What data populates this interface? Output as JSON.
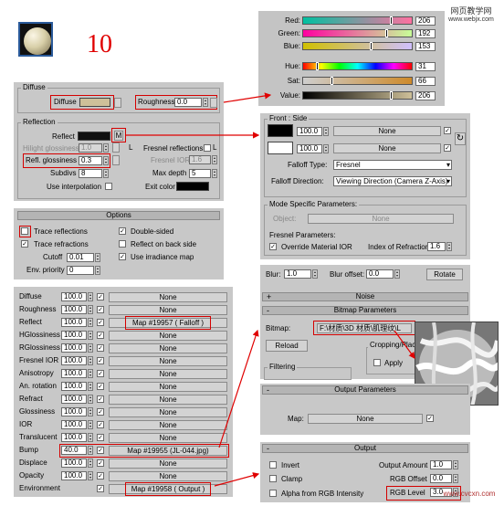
{
  "step_number": "10",
  "color_picker": {
    "channels": [
      {
        "label": "Red:",
        "value": "206"
      },
      {
        "label": "Green:",
        "value": "192"
      },
      {
        "label": "Blue:",
        "value": "153"
      },
      {
        "label": "Hue:",
        "value": "31"
      },
      {
        "label": "Sat:",
        "value": "66"
      },
      {
        "label": "Value:",
        "value": "206"
      }
    ],
    "swatch_color": "#cec099"
  },
  "watermark": {
    "line1": "网页教学网",
    "line2": "www.webjx.com"
  },
  "basic": {
    "diffuse_title": "Diffuse",
    "diffuse_label": "Diffuse",
    "roughness_label": "Roughness",
    "roughness_value": "0.0",
    "reflection_title": "Reflection",
    "reflect_label": "Reflect",
    "m_button": "M",
    "hilight_gloss_label": "Hilight glossiness",
    "hilight_gloss_value": "1.0",
    "l_button": "L",
    "fresnel_label": "Fresnel reflections",
    "refl_gloss_label": "Refl. glossiness",
    "refl_gloss_value": "0.3",
    "fresnel_ior_label": "Fresnel IOR",
    "fresnel_ior_value": "1.6",
    "subdivs_label": "Subdivs",
    "subdivs_value": "8",
    "max_depth_label": "Max depth",
    "max_depth_value": "5",
    "use_interp_label": "Use interpolation",
    "exit_color_label": "Exit color"
  },
  "options": {
    "title": "Options",
    "trace_reflections": "Trace reflections",
    "trace_refractions": "Trace refractions",
    "cutoff_label": "Cutoff",
    "cutoff_value": "0.01",
    "env_priority_label": "Env. priority",
    "env_priority_value": "0",
    "double_sided": "Double-sided",
    "reflect_back": "Reflect on back side",
    "use_irradiance": "Use irradiance map"
  },
  "maps": [
    {
      "label": "Diffuse",
      "amount": "100.0",
      "map": "None"
    },
    {
      "label": "Roughness",
      "amount": "100.0",
      "map": "None"
    },
    {
      "label": "Reflect",
      "amount": "100.0",
      "map": "Map #19957  ( Falloff )"
    },
    {
      "label": "HGlossiness",
      "amount": "100.0",
      "map": "None"
    },
    {
      "label": "RGlossiness",
      "amount": "100.0",
      "map": "None"
    },
    {
      "label": "Fresnel IOR",
      "amount": "100.0",
      "map": "None"
    },
    {
      "label": "Anisotropy",
      "amount": "100.0",
      "map": "None"
    },
    {
      "label": "An. rotation",
      "amount": "100.0",
      "map": "None"
    },
    {
      "label": "Refract",
      "amount": "100.0",
      "map": "None"
    },
    {
      "label": "Glossiness",
      "amount": "100.0",
      "map": "None"
    },
    {
      "label": "IOR",
      "amount": "100.0",
      "map": "None"
    },
    {
      "label": "Translucent",
      "amount": "100.0",
      "map": "None"
    },
    {
      "label": "Bump",
      "amount": "40.0",
      "map": "Map #19955 (JL-044.jpg)"
    },
    {
      "label": "Displace",
      "amount": "100.0",
      "map": "None"
    },
    {
      "label": "Opacity",
      "amount": "100.0",
      "map": "None"
    },
    {
      "label": "Environment",
      "amount": "",
      "map": "Map #19958  ( Output )"
    }
  ],
  "falloff": {
    "title": "Front : Side",
    "row1_value": "100.0",
    "row1_map": "None",
    "row2_value": "100.0",
    "row2_map": "None",
    "falloff_type_label": "Falloff Type:",
    "falloff_type_value": "Fresnel",
    "falloff_dir_label": "Falloff Direction:",
    "falloff_dir_value": "Viewing Direction (Camera Z-Axis)",
    "mode_title": "Mode Specific Parameters:",
    "object_label": "Object:",
    "object_value": "None",
    "fresnel_params": "Fresnel Parameters:",
    "override_ior": "Override Material IOR",
    "ior_label": "Index of Refraction",
    "ior_value": "1.6"
  },
  "bitmap": {
    "blur_label": "Blur:",
    "blur_value": "1.0",
    "blur_offset_label": "Blur offset:",
    "blur_offset_value": "0.0",
    "rotate": "Rotate",
    "noise_title": "Noise",
    "params_title": "Bitmap Parameters",
    "bitmap_label": "Bitmap:",
    "bitmap_path": "F:\\材质\\3D 材质\\肌理纹\\L",
    "reload": "Reload",
    "cropping": "Cropping/Places",
    "apply": "Apply",
    "filtering": "Filtering"
  },
  "output_params": {
    "title": "Output Parameters",
    "map_label": "Map:",
    "map_value": "None"
  },
  "output": {
    "title": "Output",
    "invert": "Invert",
    "output_amount_label": "Output Amount",
    "output_amount_value": "1.0",
    "clamp": "Clamp",
    "rgb_offset_label": "RGB Offset",
    "rgb_offset_value": "0.0",
    "alpha_label": "Alpha from RGB Intensity",
    "rgb_level_label": "RGB Level",
    "rgb_level_value": "3.0"
  },
  "bottom_watermark": "www.cvcxn.com"
}
